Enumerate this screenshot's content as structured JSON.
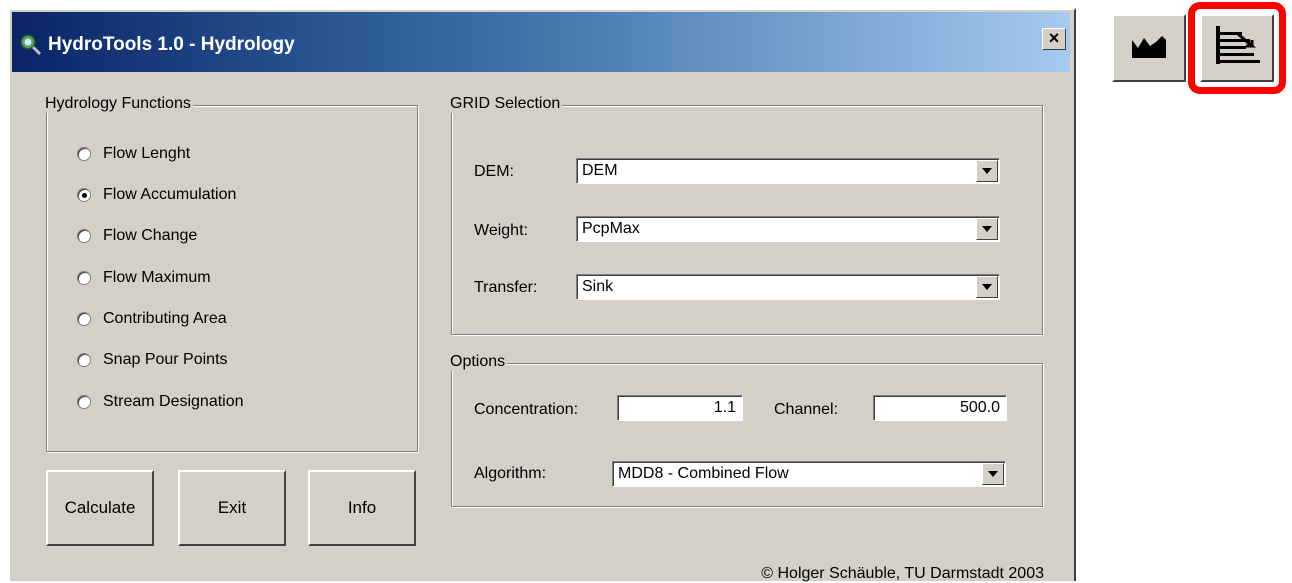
{
  "window": {
    "title": "HydroTools 1.0 - Hydrology",
    "close_label": "×"
  },
  "functions": {
    "label": "Hydrology Functions",
    "items": [
      {
        "label": "Flow Lenght",
        "checked": false
      },
      {
        "label": "Flow Accumulation",
        "checked": true
      },
      {
        "label": "Flow Change",
        "checked": false
      },
      {
        "label": "Flow Maximum",
        "checked": false
      },
      {
        "label": "Contributing Area",
        "checked": false
      },
      {
        "label": "Snap Pour Points",
        "checked": false
      },
      {
        "label": "Stream Designation",
        "checked": false
      }
    ]
  },
  "grid": {
    "label": "GRID Selection",
    "dem_label": "DEM:",
    "dem_value": "DEM",
    "weight_label": "Weight:",
    "weight_value": "PcpMax",
    "transfer_label": "Transfer:",
    "transfer_value": "Sink"
  },
  "options": {
    "label": "Options",
    "concentration_label": "Concentration:",
    "concentration_value": "1.1",
    "channel_label": "Channel:",
    "channel_value": "500.0",
    "algorithm_label": "Algorithm:",
    "algorithm_value": "MDD8 - Combined Flow"
  },
  "buttons": {
    "calculate": "Calculate",
    "exit": "Exit",
    "info": "Info"
  },
  "footer": {
    "copyright": "© Holger Schäuble, TU Darmstadt 2003"
  },
  "toolbar": {
    "icons": [
      "terrain-icon",
      "flow-accumulation-icon"
    ],
    "highlight_color": "#ff0000"
  }
}
